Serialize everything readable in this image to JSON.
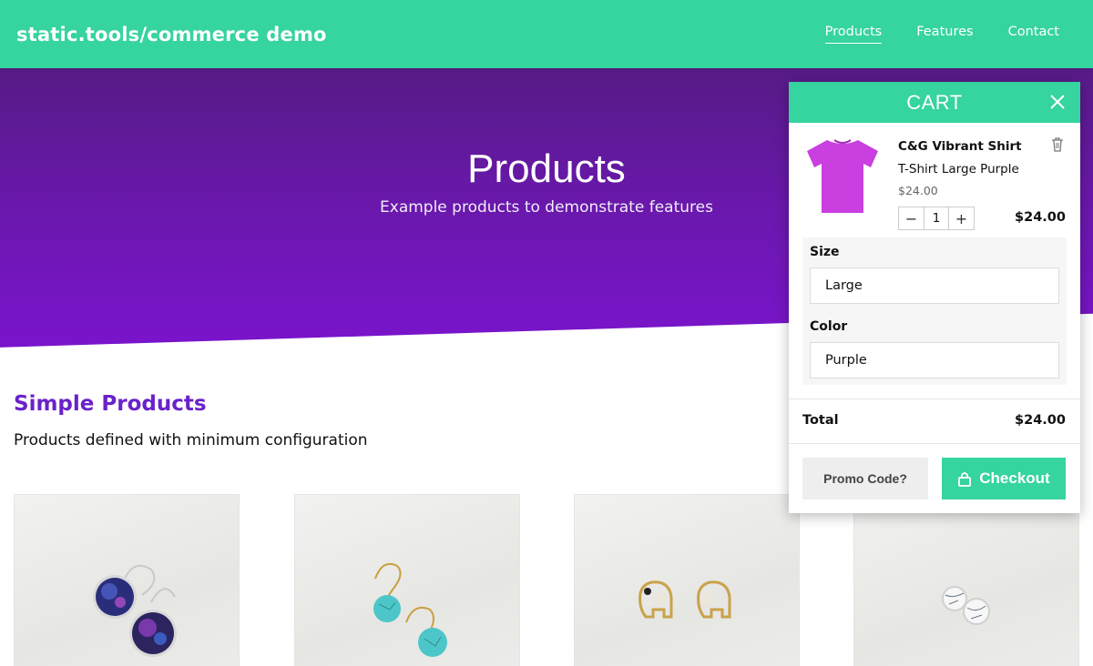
{
  "header": {
    "brand": "static.tools/commerce demo",
    "nav": [
      "Products",
      "Features",
      "Contact"
    ],
    "active_nav": "Products",
    "accent_color": "#36d49f"
  },
  "hero": {
    "title": "Products",
    "subtitle": "Example products to demonstrate features",
    "gradient_colors": [
      "#571b86",
      "#7b14cd"
    ]
  },
  "section": {
    "title": "Simple Products",
    "description": "Products defined with minimum configuration",
    "title_color": "#6a22c9"
  },
  "products": [
    {
      "image": "galaxy-earrings-image"
    },
    {
      "image": "turquoise-earrings-image"
    },
    {
      "image": "elephant-earrings-image"
    },
    {
      "image": "marble-earrings-image"
    }
  ],
  "cart": {
    "title": "CART",
    "close_icon": "close-icon",
    "item": {
      "name": "C&G Vibrant Shirt",
      "variant": "T-Shirt Large Purple",
      "unit_price": "$24.00",
      "quantity": "1",
      "line_total": "$24.00",
      "image_icon": "purple-tshirt-image",
      "delete_icon": "trash-icon"
    },
    "options": {
      "size_label": "Size",
      "size_value": "Large",
      "color_label": "Color",
      "color_value": "Purple"
    },
    "total_label": "Total",
    "total_value": "$24.00",
    "promo_label": "Promo Code?",
    "checkout_label": "Checkout",
    "checkout_icon": "lock-icon"
  }
}
